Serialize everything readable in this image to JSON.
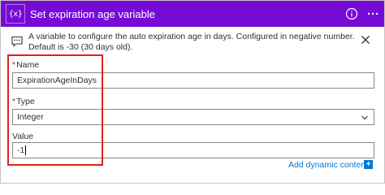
{
  "header": {
    "icon_text": "{x}",
    "title": "Set expiration age variable",
    "accent_color": "#770bd6"
  },
  "notice": {
    "text": "A variable to configure the auto expiration age in days. Configured in negative number. Default is -30 (30 days old)."
  },
  "fields": {
    "name": {
      "label": "Name",
      "required_mark": "*",
      "value": "ExpirationAgeInDays"
    },
    "type": {
      "label": "Type",
      "required_mark": "*",
      "value": "Integer"
    },
    "value": {
      "label": "Value",
      "value": "-1"
    }
  },
  "footer": {
    "dynamic_content_label": "Add dynamic content",
    "dynamic_content_icon": "+"
  },
  "icons": [
    "variable-icon",
    "info-icon",
    "more-icon",
    "comment-icon",
    "close-icon",
    "chevron-down-icon",
    "add-icon"
  ]
}
